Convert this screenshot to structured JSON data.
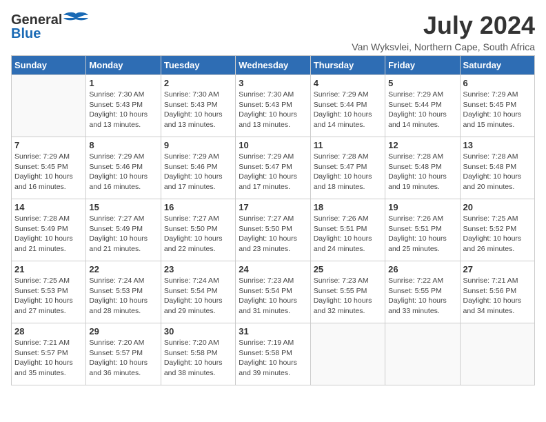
{
  "header": {
    "logo_general": "General",
    "logo_blue": "Blue",
    "month_title": "July 2024",
    "location": "Van Wyksvlei, Northern Cape, South Africa"
  },
  "weekdays": [
    "Sunday",
    "Monday",
    "Tuesday",
    "Wednesday",
    "Thursday",
    "Friday",
    "Saturday"
  ],
  "weeks": [
    [
      {
        "day": "",
        "sunrise": "",
        "sunset": "",
        "daylight": ""
      },
      {
        "day": "1",
        "sunrise": "7:30 AM",
        "sunset": "5:43 PM",
        "daylight": "10 hours and 13 minutes."
      },
      {
        "day": "2",
        "sunrise": "7:30 AM",
        "sunset": "5:43 PM",
        "daylight": "10 hours and 13 minutes."
      },
      {
        "day": "3",
        "sunrise": "7:30 AM",
        "sunset": "5:43 PM",
        "daylight": "10 hours and 13 minutes."
      },
      {
        "day": "4",
        "sunrise": "7:29 AM",
        "sunset": "5:44 PM",
        "daylight": "10 hours and 14 minutes."
      },
      {
        "day": "5",
        "sunrise": "7:29 AM",
        "sunset": "5:44 PM",
        "daylight": "10 hours and 14 minutes."
      },
      {
        "day": "6",
        "sunrise": "7:29 AM",
        "sunset": "5:45 PM",
        "daylight": "10 hours and 15 minutes."
      }
    ],
    [
      {
        "day": "7",
        "sunrise": "7:29 AM",
        "sunset": "5:45 PM",
        "daylight": "10 hours and 16 minutes."
      },
      {
        "day": "8",
        "sunrise": "7:29 AM",
        "sunset": "5:46 PM",
        "daylight": "10 hours and 16 minutes."
      },
      {
        "day": "9",
        "sunrise": "7:29 AM",
        "sunset": "5:46 PM",
        "daylight": "10 hours and 17 minutes."
      },
      {
        "day": "10",
        "sunrise": "7:29 AM",
        "sunset": "5:47 PM",
        "daylight": "10 hours and 17 minutes."
      },
      {
        "day": "11",
        "sunrise": "7:28 AM",
        "sunset": "5:47 PM",
        "daylight": "10 hours and 18 minutes."
      },
      {
        "day": "12",
        "sunrise": "7:28 AM",
        "sunset": "5:48 PM",
        "daylight": "10 hours and 19 minutes."
      },
      {
        "day": "13",
        "sunrise": "7:28 AM",
        "sunset": "5:48 PM",
        "daylight": "10 hours and 20 minutes."
      }
    ],
    [
      {
        "day": "14",
        "sunrise": "7:28 AM",
        "sunset": "5:49 PM",
        "daylight": "10 hours and 21 minutes."
      },
      {
        "day": "15",
        "sunrise": "7:27 AM",
        "sunset": "5:49 PM",
        "daylight": "10 hours and 21 minutes."
      },
      {
        "day": "16",
        "sunrise": "7:27 AM",
        "sunset": "5:50 PM",
        "daylight": "10 hours and 22 minutes."
      },
      {
        "day": "17",
        "sunrise": "7:27 AM",
        "sunset": "5:50 PM",
        "daylight": "10 hours and 23 minutes."
      },
      {
        "day": "18",
        "sunrise": "7:26 AM",
        "sunset": "5:51 PM",
        "daylight": "10 hours and 24 minutes."
      },
      {
        "day": "19",
        "sunrise": "7:26 AM",
        "sunset": "5:51 PM",
        "daylight": "10 hours and 25 minutes."
      },
      {
        "day": "20",
        "sunrise": "7:25 AM",
        "sunset": "5:52 PM",
        "daylight": "10 hours and 26 minutes."
      }
    ],
    [
      {
        "day": "21",
        "sunrise": "7:25 AM",
        "sunset": "5:53 PM",
        "daylight": "10 hours and 27 minutes."
      },
      {
        "day": "22",
        "sunrise": "7:24 AM",
        "sunset": "5:53 PM",
        "daylight": "10 hours and 28 minutes."
      },
      {
        "day": "23",
        "sunrise": "7:24 AM",
        "sunset": "5:54 PM",
        "daylight": "10 hours and 29 minutes."
      },
      {
        "day": "24",
        "sunrise": "7:23 AM",
        "sunset": "5:54 PM",
        "daylight": "10 hours and 31 minutes."
      },
      {
        "day": "25",
        "sunrise": "7:23 AM",
        "sunset": "5:55 PM",
        "daylight": "10 hours and 32 minutes."
      },
      {
        "day": "26",
        "sunrise": "7:22 AM",
        "sunset": "5:55 PM",
        "daylight": "10 hours and 33 minutes."
      },
      {
        "day": "27",
        "sunrise": "7:21 AM",
        "sunset": "5:56 PM",
        "daylight": "10 hours and 34 minutes."
      }
    ],
    [
      {
        "day": "28",
        "sunrise": "7:21 AM",
        "sunset": "5:57 PM",
        "daylight": "10 hours and 35 minutes."
      },
      {
        "day": "29",
        "sunrise": "7:20 AM",
        "sunset": "5:57 PM",
        "daylight": "10 hours and 36 minutes."
      },
      {
        "day": "30",
        "sunrise": "7:20 AM",
        "sunset": "5:58 PM",
        "daylight": "10 hours and 38 minutes."
      },
      {
        "day": "31",
        "sunrise": "7:19 AM",
        "sunset": "5:58 PM",
        "daylight": "10 hours and 39 minutes."
      },
      {
        "day": "",
        "sunrise": "",
        "sunset": "",
        "daylight": ""
      },
      {
        "day": "",
        "sunrise": "",
        "sunset": "",
        "daylight": ""
      },
      {
        "day": "",
        "sunrise": "",
        "sunset": "",
        "daylight": ""
      }
    ]
  ],
  "labels": {
    "sunrise": "Sunrise:",
    "sunset": "Sunset:",
    "daylight": "Daylight: "
  }
}
